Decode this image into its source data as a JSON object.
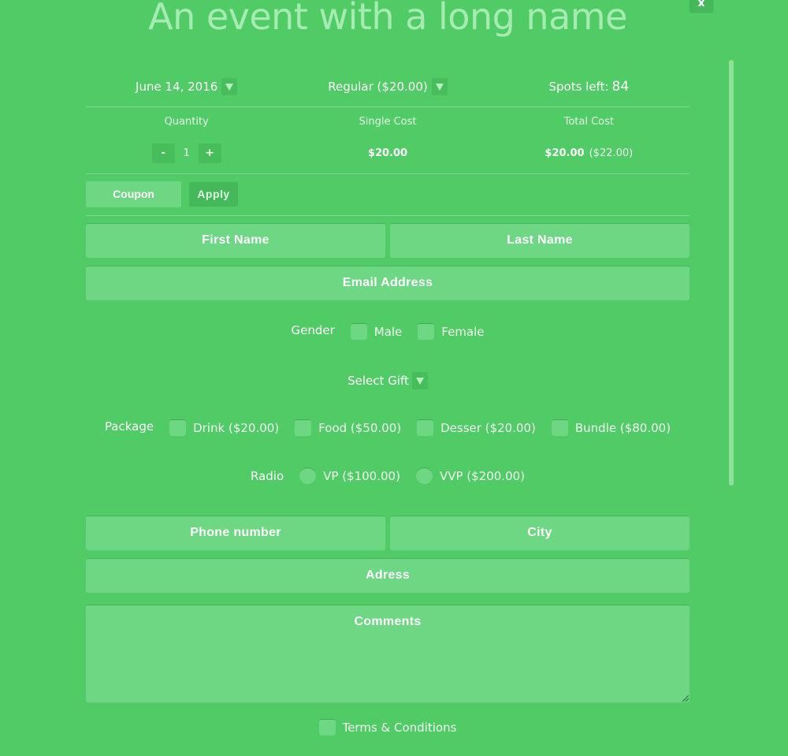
{
  "event": {
    "title": "An event with a long name"
  },
  "close_label": "x",
  "selectors": {
    "date": "June 14, 2016",
    "ticket": "Regular ($20.00)",
    "spots_label": "Spots left:",
    "spots_value": "84"
  },
  "costs": {
    "quantity_label": "Quantity",
    "single_label": "Single Cost",
    "total_label": "Total Cost",
    "decrement": "-",
    "increment": "+",
    "quantity": "1",
    "single_value": "$20.00",
    "total_value": "$20.00",
    "total_with_tax": "($22.00)"
  },
  "coupon": {
    "placeholder": "Coupon",
    "apply_label": "Apply"
  },
  "fields": {
    "first_name": "First Name",
    "last_name": "Last Name",
    "email": "Email Address",
    "phone": "Phone number",
    "city": "City",
    "address": "Adress",
    "comments": "Comments"
  },
  "gender": {
    "label": "Gender",
    "options": [
      "Male",
      "Female"
    ]
  },
  "gift": {
    "label": "Select Gift"
  },
  "package": {
    "label": "Package",
    "options": [
      "Drink ($20.00)",
      "Food ($50.00)",
      "Desser ($20.00)",
      "Bundle ($80.00)"
    ]
  },
  "radio": {
    "label": "Radio",
    "options": [
      "VP ($100.00)",
      "VVP ($200.00)"
    ]
  },
  "terms": {
    "label": "Terms & Conditions"
  }
}
